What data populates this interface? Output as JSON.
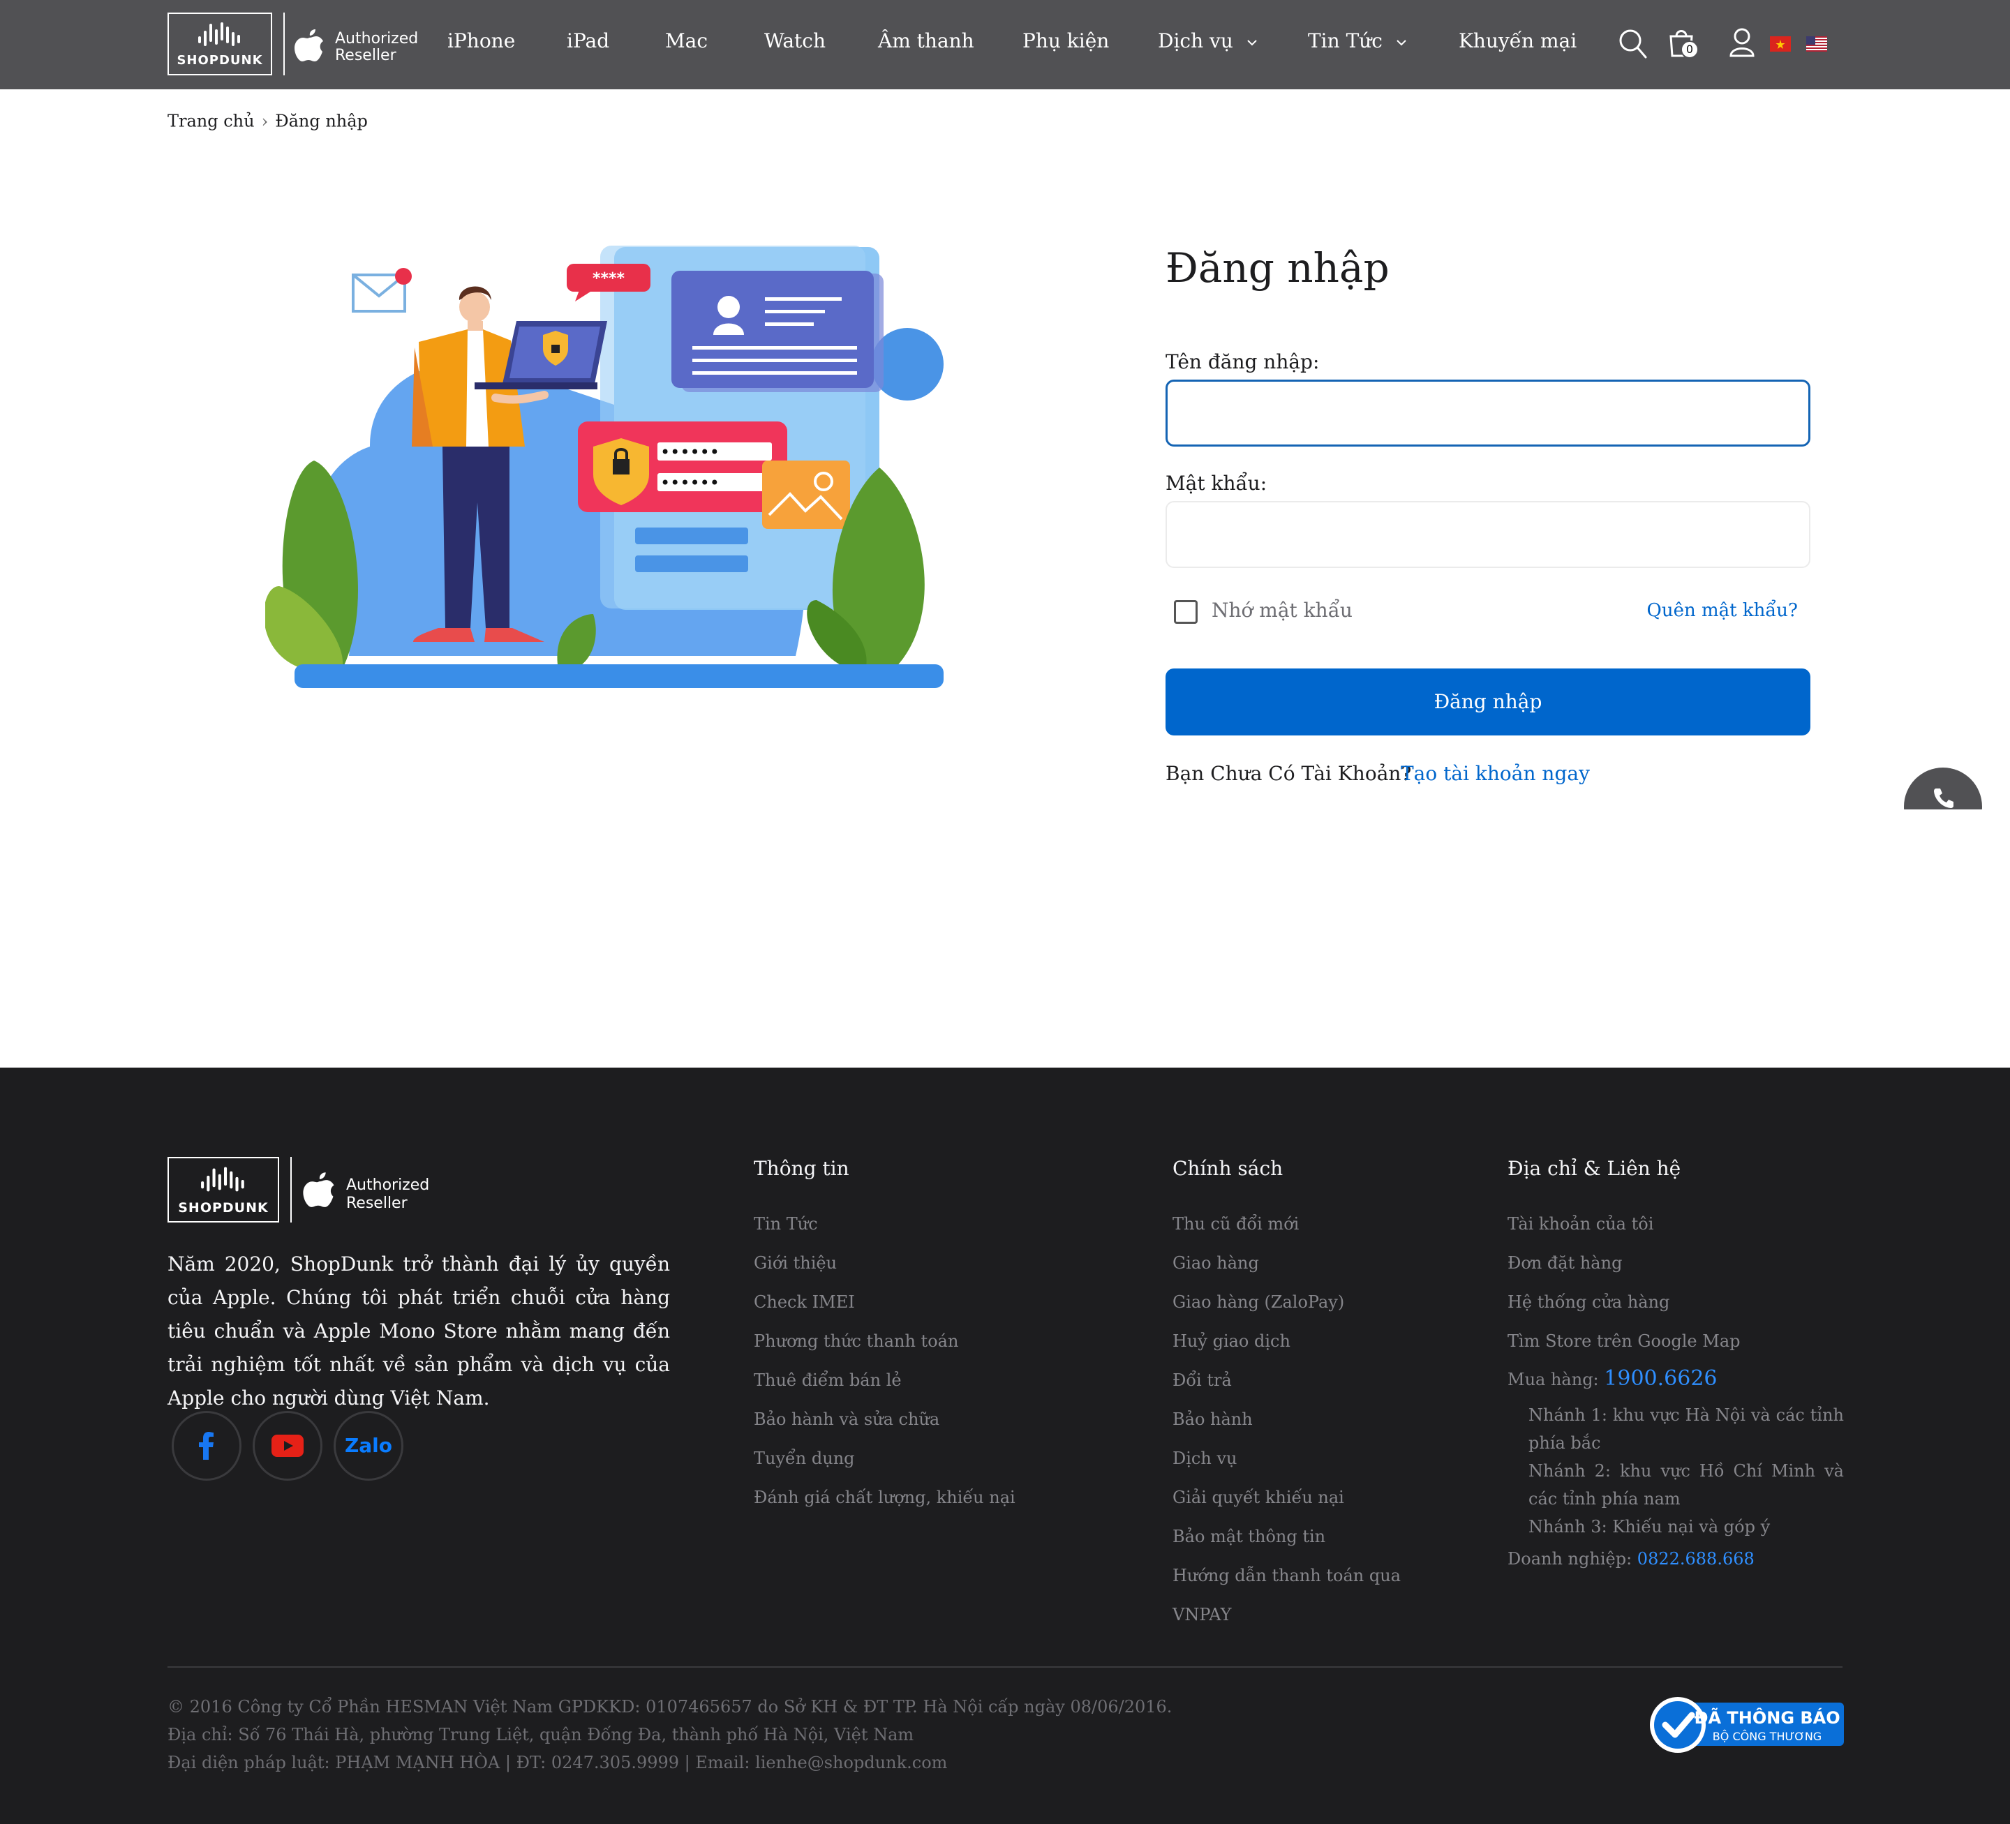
{
  "header": {
    "logo_text": "SHOPDUNK",
    "authorized_line1": "Authorized",
    "authorized_line2": "Reseller",
    "nav": [
      {
        "label": "iPhone"
      },
      {
        "label": "iPad"
      },
      {
        "label": "Mac"
      },
      {
        "label": "Watch"
      },
      {
        "label": "Âm thanh"
      },
      {
        "label": "Phụ kiện"
      },
      {
        "label": "Dịch vụ"
      },
      {
        "label": "Tin Tức"
      },
      {
        "label": "Khuyến mại"
      }
    ],
    "cart_count": "0"
  },
  "breadcrumb": {
    "home": "Trang chủ",
    "separator": "›",
    "current": "Đăng nhập"
  },
  "illustration": {
    "password_bubble": "****",
    "dots": "••••••"
  },
  "login": {
    "title": "Đăng nhập",
    "username_label": "Tên đăng nhập:",
    "username_value": "",
    "password_label": "Mật khẩu:",
    "password_value": "",
    "remember_label": "Nhớ mật khẩu",
    "remember_checked": false,
    "forgot_link": "Quên mật khẩu?",
    "submit_label": "Đăng nhập",
    "no_account_text": "Bạn Chưa Có Tài Khoản?",
    "signup_link": "Tạo tài khoản ngay"
  },
  "footer": {
    "logo_text": "SHOPDUNK",
    "authorized_line1": "Authorized",
    "authorized_line2": "Reseller",
    "about": "Năm 2020, ShopDunk trở thành đại lý ủy quyền của Apple. Chúng tôi phát triển chuỗi cửa hàng tiêu chuẩn và Apple Mono Store nhằm mang đến trải nghiệm tốt nhất về sản phẩm và dịch vụ của Apple cho người dùng Việt Nam.",
    "social": [
      {
        "name": "facebook",
        "icon": "facebook-icon"
      },
      {
        "name": "youtube",
        "icon": "youtube-icon"
      },
      {
        "name": "zalo",
        "label": "Zalo"
      }
    ],
    "columns": {
      "info": {
        "title": "Thông tin",
        "links": [
          "Tin Tức",
          "Giới thiệu",
          "Check IMEI",
          "Phương thức thanh toán",
          "Thuê điểm bán lẻ",
          "Bảo hành và sửa chữa",
          "Tuyển dụng",
          "Đánh giá chất lượng, khiếu nại"
        ]
      },
      "policy": {
        "title": "Chính sách",
        "links": [
          "Thu cũ đổi mới",
          "Giao hàng",
          "Giao hàng (ZaloPay)",
          "Huỷ giao dịch",
          "Đổi trả",
          "Bảo hành",
          "Dịch vụ",
          "Giải quyết khiếu nại",
          "Bảo mật thông tin",
          "Hướng dẫn thanh toán qua",
          "VNPAY"
        ]
      },
      "contact": {
        "title": "Địa chỉ & Liên hệ",
        "links": [
          "Tài khoản của tôi",
          "Đơn đặt hàng",
          "Hệ thống cửa hàng",
          "Tìm Store trên Google Map"
        ],
        "buy_label": "Mua hàng:",
        "hotline": "1900.6626",
        "branches": [
          "Nhánh 1: khu vực Hà Nội và các tỉnh phía bắc",
          "Nhánh 2: khu vực Hồ Chí Minh và các tỉnh phía nam",
          "Nhánh 3: Khiếu nại và góp ý"
        ],
        "business_label": "Doanh nghiệp:",
        "business_phone": "0822.688.668"
      }
    },
    "copyright": [
      "© 2016 Công ty Cổ Phần HESMAN Việt Nam GPDKKD: 0107465657 do Sở KH & ĐT TP. Hà Nội cấp ngày 08/06/2016.",
      "Địa chỉ: Số 76 Thái Hà, phường Trung Liệt, quận Đống Đa, thành phố Hà Nội, Việt Nam",
      "Đại diện pháp luật: PHẠM MẠNH HÒA | ĐT: 0247.305.9999 | Email: lienhe@shopdunk.com"
    ],
    "badge": {
      "line1": "ĐÃ THÔNG BÁO",
      "line2": "BỘ CÔNG THƯƠNG"
    }
  },
  "colors": {
    "header_bg": "#515154",
    "footer_bg": "#1d1d1f",
    "primary": "#0066cc",
    "link_blue": "#2f8fff"
  }
}
